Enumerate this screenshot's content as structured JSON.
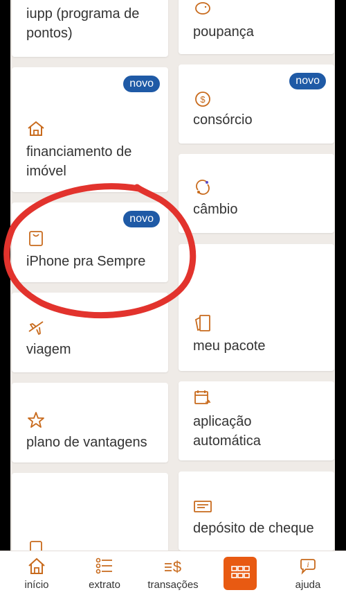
{
  "cards": {
    "iupp": {
      "label": "iupp (programa de pontos)"
    },
    "poupanca": {
      "label": "poupança"
    },
    "financiamento": {
      "label": "financiamento de imóvel",
      "badge": "novo"
    },
    "consorcio": {
      "label": "consórcio",
      "badge": "novo"
    },
    "cambio": {
      "label": "câmbio"
    },
    "iphone": {
      "label": "iPhone pra Sempre",
      "badge": "novo"
    },
    "viagem": {
      "label": "viagem"
    },
    "meu_pacote": {
      "label": "meu pacote"
    },
    "plano_vantagens": {
      "label": "plano de vantagens"
    },
    "aplicacao": {
      "label": "aplicação automática"
    },
    "deposito": {
      "label": "depósito de cheque"
    }
  },
  "bottom_nav": {
    "inicio": "início",
    "extrato": "extrato",
    "transacoes": "transações",
    "ajuda": "ajuda"
  },
  "colors": {
    "accent": "#e85a12",
    "badge": "#1f5aa6",
    "highlight_circle": "#e2332d",
    "icon": "#c86a1c"
  }
}
